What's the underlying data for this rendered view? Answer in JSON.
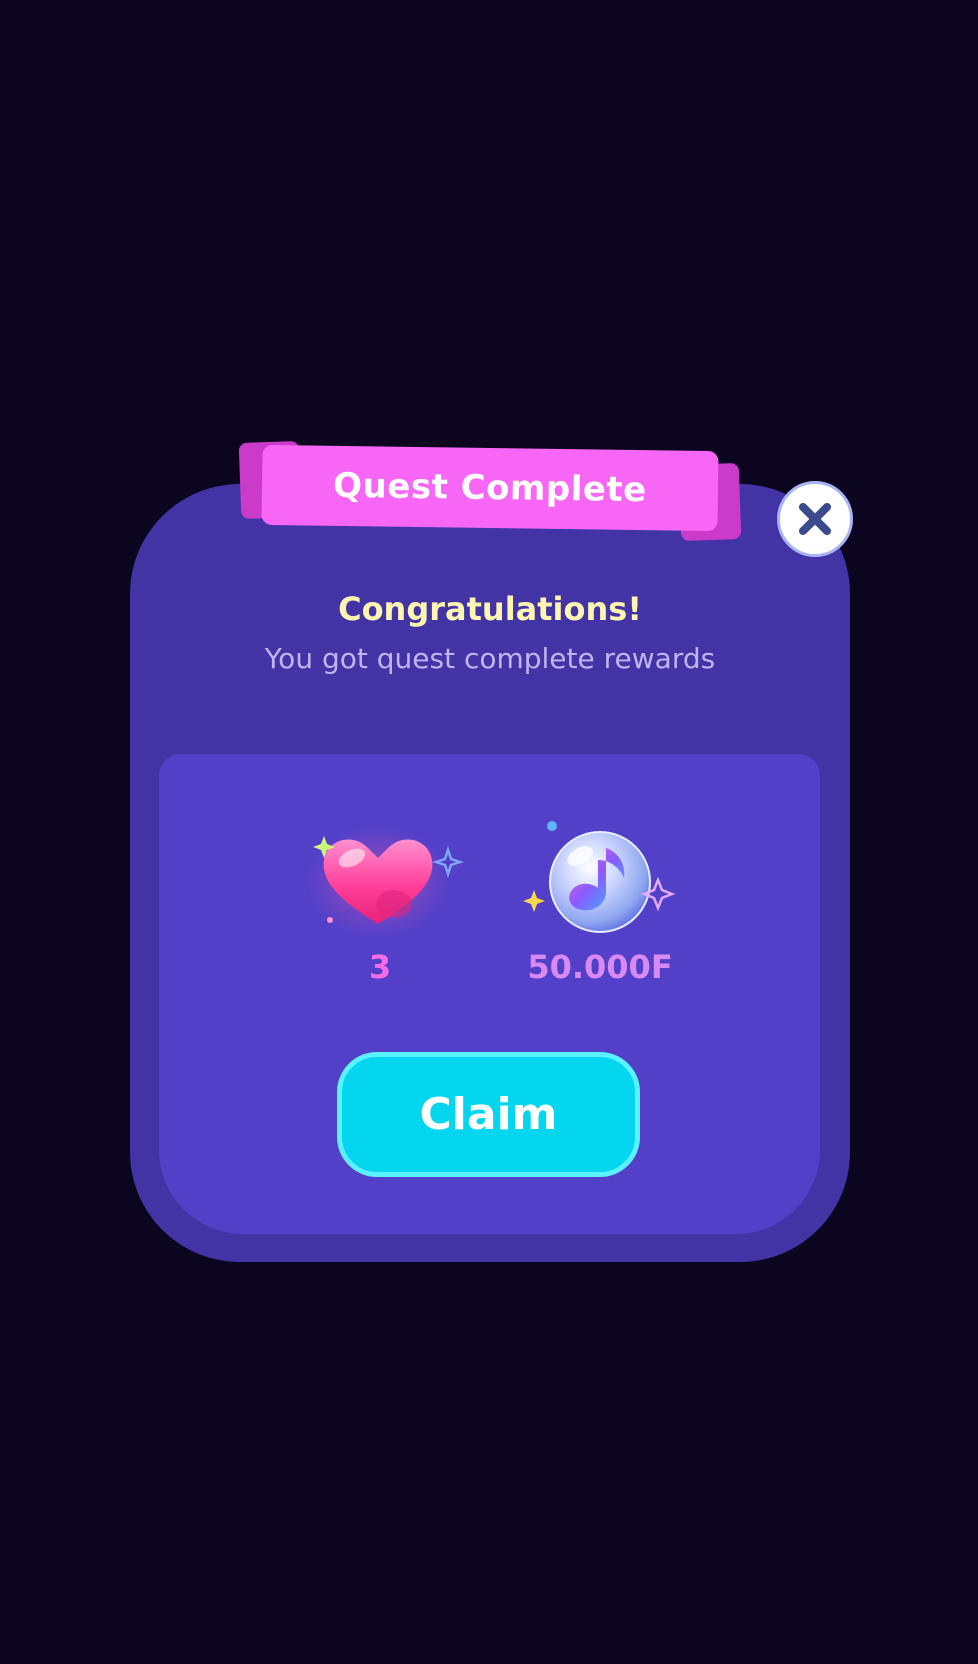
{
  "dialog": {
    "title": "Quest Complete",
    "heading": "Congratulations!",
    "subtitle": "You got quest complete rewards",
    "close_icon": "close-icon"
  },
  "rewards": [
    {
      "icon": "heart-icon",
      "value": "3"
    },
    {
      "icon": "music-orb-icon",
      "value": "50.000F"
    }
  ],
  "actions": {
    "claim_label": "Claim"
  },
  "colors": {
    "background": "#0c0520",
    "dialog": "#4234a4",
    "panel": "#5340c8",
    "ribbon": "#f766f4",
    "claim": "#03d6ee",
    "heading": "#fdf5b0"
  }
}
